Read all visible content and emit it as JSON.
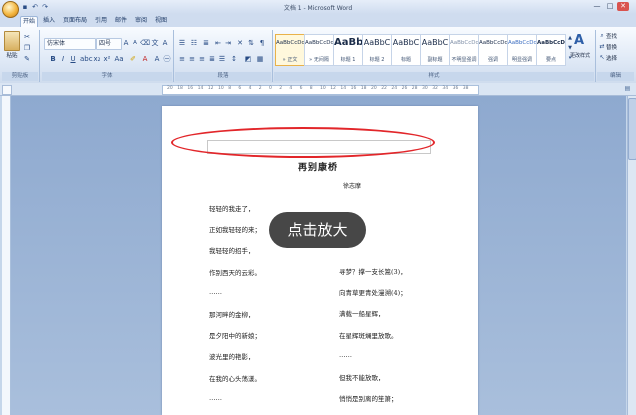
{
  "window": {
    "title": "文档 1 - Microsoft Word",
    "controls": [
      "—",
      "□",
      "✕"
    ]
  },
  "quick_access": [
    "save-icon",
    "undo-icon",
    "redo-icon"
  ],
  "tabs": [
    "开始",
    "插入",
    "页面布局",
    "引用",
    "邮件",
    "审阅",
    "视图"
  ],
  "ribbon": {
    "groups": [
      "剪贴板",
      "字体",
      "段落",
      "样式",
      "编辑"
    ],
    "font_name": "仿宋体",
    "font_size": "四号",
    "paste_label": "粘贴",
    "change_styles_label": "更改样式",
    "find_label": "查找",
    "replace_label": "替换",
    "select_label": "选择",
    "styles": [
      {
        "sample": "AaBbCcDd",
        "name": "» 正文"
      },
      {
        "sample": "AaBbCcDd",
        "name": "» 无间隔"
      },
      {
        "sample": "AaBb",
        "name": "标题 1"
      },
      {
        "sample": "AaBbC",
        "name": "标题 2"
      },
      {
        "sample": "AaBbC",
        "name": "标题"
      },
      {
        "sample": "AaBbC",
        "name": "副标题"
      },
      {
        "sample": "AaBbCcDd",
        "name": "不明显强调"
      },
      {
        "sample": "AaBbCcDd",
        "name": "强调"
      },
      {
        "sample": "AaBbCcDd",
        "name": "明显强调"
      },
      {
        "sample": "AaBbCcDc",
        "name": "要点"
      }
    ]
  },
  "document": {
    "title": "再别康桥",
    "author": "徐志摩",
    "left_lines": [
      "轻轻的我走了，",
      "正如我轻轻的来；",
      "我轻轻的招手，",
      "作别西天的云彩。",
      "……",
      "那河畔的金柳，",
      "是夕阳中的新娘；",
      "波光里的艳影，",
      "在我的心头荡漾。",
      "……"
    ],
    "right_lines": [
      "寻梦？撑一支长篙(3)，",
      "向青草更青处漫溯(4)；",
      "满载一船星辉，",
      "在星辉斑斓里放歌。",
      "……",
      "但我不能放歌，",
      "悄悄是别离的笙箫；"
    ]
  },
  "overlay": {
    "zoom_label": "点击放大"
  },
  "colors": {
    "annotation_oval": "#e2262a",
    "workspace": "#8ea9cf"
  }
}
